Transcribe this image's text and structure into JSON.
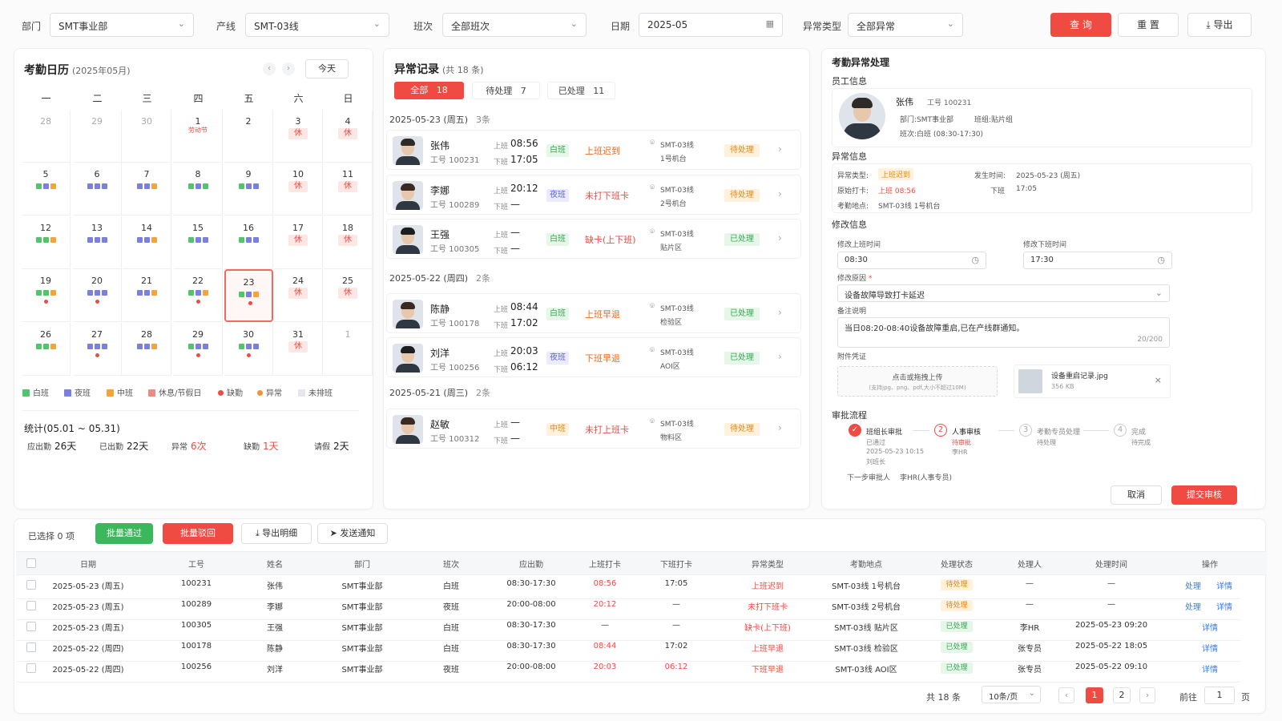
{
  "filters": {
    "dept_label": "部门",
    "dept_value": "SMT事业部",
    "line_label": "产线",
    "line_value": "SMT-03线",
    "shift_label": "班次",
    "shift_value": "全部班次",
    "date_label": "日期",
    "date_value": "2025-05",
    "type_label": "异常类型",
    "type_value": "全部异常",
    "query": "查 询",
    "reset": "重 置",
    "export": "导出"
  },
  "calendar": {
    "title": "考勤日历",
    "subtitle": "(2025年05月)",
    "today": "今天",
    "weekdays": [
      "一",
      "二",
      "三",
      "四",
      "五",
      "六",
      "日"
    ],
    "days": [
      {
        "n": "28",
        "dim": true
      },
      {
        "n": "29",
        "dim": true
      },
      {
        "n": "30",
        "dim": true
      },
      {
        "n": "1",
        "fest": "劳动节"
      },
      {
        "n": "2"
      },
      {
        "n": "3",
        "rest": "休"
      },
      {
        "n": "4",
        "rest": "休"
      },
      {
        "n": "5",
        "d": "gpo"
      },
      {
        "n": "6",
        "d": "ppp"
      },
      {
        "n": "7",
        "d": "ppo"
      },
      {
        "n": "8",
        "d": "gpg"
      },
      {
        "n": "9",
        "d": "gpp"
      },
      {
        "n": "10",
        "rest": "休"
      },
      {
        "n": "11",
        "rest": "休"
      },
      {
        "n": "12",
        "d": "ggo"
      },
      {
        "n": "13",
        "d": "ppp"
      },
      {
        "n": "14",
        "d": "ppo"
      },
      {
        "n": "15",
        "d": "gpp"
      },
      {
        "n": "16",
        "d": "gpp"
      },
      {
        "n": "17",
        "rest": "休"
      },
      {
        "n": "18",
        "rest": "休"
      },
      {
        "n": "19",
        "d": "ggo",
        "dot": "r"
      },
      {
        "n": "20",
        "d": "ppp",
        "dot": "r"
      },
      {
        "n": "21",
        "d": "ppo"
      },
      {
        "n": "22",
        "d": "gpo",
        "dot": "r"
      },
      {
        "n": "23",
        "d": "gpo",
        "dot": "r",
        "sel": true
      },
      {
        "n": "24",
        "rest": "休"
      },
      {
        "n": "25",
        "rest": "休"
      },
      {
        "n": "26",
        "d": "ggo"
      },
      {
        "n": "27",
        "d": "ppp",
        "dot": "r"
      },
      {
        "n": "28",
        "d": "ppo"
      },
      {
        "n": "29",
        "d": "gpp",
        "dot": "r"
      },
      {
        "n": "30",
        "d": "gpp",
        "dot": "r"
      },
      {
        "n": "31",
        "rest": "休"
      },
      {
        "n": "1",
        "dim": true
      }
    ],
    "legend": [
      "白班",
      "夜班",
      "中班",
      "休息/节假日",
      "缺勤",
      "异常",
      "未排班"
    ],
    "stats_title": "统计(05.01 ~ 05.31)",
    "stats": [
      {
        "label": "应出勤",
        "value": "26天"
      },
      {
        "label": "已出勤",
        "value": "22天"
      },
      {
        "label": "异常",
        "value": "6次",
        "red": true
      },
      {
        "label": "缺勤",
        "value": "1天",
        "red": true
      },
      {
        "label": "请假",
        "value": "2天"
      }
    ]
  },
  "records": {
    "title": "异常记录",
    "subtitle": "(共 18 条)",
    "tabs": [
      {
        "label": "全部",
        "count": "18"
      },
      {
        "label": "待处理",
        "count": "7"
      },
      {
        "label": "已处理",
        "count": "11"
      }
    ],
    "groups": [
      {
        "date": "2025-05-23 (周五)",
        "count": "3条"
      },
      {
        "date": "2025-05-22 (周四)",
        "count": "2条"
      },
      {
        "date": "2025-05-21 (周三)",
        "count": "2条"
      }
    ],
    "on_label": "上班",
    "off_label": "下班",
    "items": [
      {
        "name": "张伟",
        "id": "工号 100231",
        "on": "08:56",
        "off": "17:05",
        "shift": "白班",
        "stype": "day",
        "type": "上班迟到",
        "twarn": true,
        "loc1": "SMT-03线",
        "loc2": "1号机台",
        "status": "待处理",
        "st": "pend",
        "hair": "#2d2a28"
      },
      {
        "name": "李娜",
        "id": "工号 100289",
        "on": "20:12",
        "off": "—",
        "shift": "夜班",
        "stype": "night",
        "type": "未打下班卡",
        "twarn": false,
        "loc1": "SMT-03线",
        "loc2": "2号机台",
        "status": "待处理",
        "st": "pend",
        "hair": "#3a2a22"
      },
      {
        "name": "王强",
        "id": "工号 100305",
        "on": "—",
        "off": "—",
        "shift": "白班",
        "stype": "day",
        "type": "缺卡(上下班)",
        "twarn": false,
        "loc1": "SMT-03线",
        "loc2": "贴片区",
        "status": "已处理",
        "st": "done",
        "hair": "#1e1e1e"
      },
      {
        "name": "陈静",
        "id": "工号 100178",
        "on": "08:44",
        "off": "17:02",
        "shift": "白班",
        "stype": "day",
        "type": "上班早退",
        "twarn": true,
        "loc1": "SMT-03线",
        "loc2": "检验区",
        "status": "已处理",
        "st": "done",
        "hair": "#3a2a22"
      },
      {
        "name": "刘洋",
        "id": "工号 100256",
        "on": "20:03",
        "off": "06:12",
        "shift": "夜班",
        "stype": "night",
        "type": "下班早退",
        "twarn": true,
        "loc1": "SMT-03线",
        "loc2": "AOI区",
        "status": "已处理",
        "st": "done",
        "hair": "#1e1e1e"
      },
      {
        "name": "赵敏",
        "id": "工号 100312",
        "on": "—",
        "off": "—",
        "shift": "中班",
        "stype": "mid",
        "type": "未打上班卡",
        "twarn": false,
        "loc1": "SMT-03线",
        "loc2": "物料区",
        "status": "待处理",
        "st": "pend",
        "hair": "#3a2a22"
      }
    ]
  },
  "handler": {
    "title": "考勤异常处理",
    "emp_section": "员工信息",
    "emp_name": "张伟",
    "emp_id": "工号 100231",
    "emp_dept": "部门:SMT事业部",
    "emp_team": "班组:贴片组",
    "emp_shift": "班次:白班 (08:30-17:30)",
    "abn_section": "异常信息",
    "abn_type_label": "异常类型:",
    "abn_type": "上班迟到",
    "abn_time_label": "发生时间:",
    "abn_time": "2025-05-23 (周五)",
    "orig_label": "原始打卡:",
    "orig_on": "上班 08:56",
    "orig_off_label": "下班",
    "orig_off": "17:05",
    "place_label": "考勤地点:",
    "place": "SMT-03线 1号机台",
    "mod_section": "修改信息",
    "mod_on_label": "修改上班时间",
    "mod_on": "08:30",
    "mod_off_label": "修改下班时间",
    "mod_off": "17:30",
    "reason_label": "修改原因",
    "reason": "设备故障导致打卡延迟",
    "remark_label": "备注说明",
    "remark": "当日08:20-08:40设备故障重启,已在产线群通知。",
    "remark_count": "20/200",
    "attach_label": "附件凭证",
    "upload_text": "点击或拖拽上传",
    "upload_hint": "(支持jpg、png、pdf,大小不超过10M)",
    "file_name": "设备重启记录.jpg",
    "file_size": "356 KB",
    "flow_section": "审批流程",
    "steps": [
      {
        "name": "班组长审批",
        "s1": "已通过",
        "s2": "2025-05-23 10:15",
        "s3": "刘班长"
      },
      {
        "name": "人事审核",
        "s1": "待审批",
        "s2": "李HR",
        "s3": ""
      },
      {
        "name": "考勤专员处理",
        "s1": "待处理",
        "s2": "",
        "s3": ""
      },
      {
        "name": "完成",
        "s1": "待完成",
        "s2": "",
        "s3": ""
      }
    ],
    "next_label": "下一步审批人",
    "next_value": "李HR(人事专员)",
    "cancel": "取消",
    "submit": "提交审核"
  },
  "bulk": {
    "selected": "已选择 0 项",
    "approve": "批量通过",
    "reject": "批量驳回",
    "export": "导出明细",
    "notify": "发送通知"
  },
  "table": {
    "headers": [
      "日期",
      "工号",
      "姓名",
      "部门",
      "班次",
      "应出勤",
      "上班打卡",
      "下班打卡",
      "异常类型",
      "考勤地点",
      "处理状态",
      "处理人",
      "处理时间",
      "操作"
    ],
    "rows": [
      [
        "2025-05-23 (周五)",
        "100231",
        "张伟",
        "SMT事业部",
        "白班",
        "08:30-17:30",
        "08:56",
        "17:05",
        "上班迟到",
        "SMT-03线 1号机台",
        "待处理",
        "—",
        "—"
      ],
      [
        "2025-05-23 (周五)",
        "100289",
        "李娜",
        "SMT事业部",
        "夜班",
        "20:00-08:00",
        "20:12",
        "—",
        "未打下班卡",
        "SMT-03线 2号机台",
        "待处理",
        "—",
        "—"
      ],
      [
        "2025-05-23 (周五)",
        "100305",
        "王强",
        "SMT事业部",
        "白班",
        "08:30-17:30",
        "—",
        "—",
        "缺卡(上下班)",
        "SMT-03线 贴片区",
        "已处理",
        "李HR",
        "2025-05-23 09:20"
      ],
      [
        "2025-05-22 (周四)",
        "100178",
        "陈静",
        "SMT事业部",
        "白班",
        "08:30-17:30",
        "08:44",
        "17:02",
        "上班早退",
        "SMT-03线 检验区",
        "已处理",
        "张专员",
        "2025-05-22 18:05"
      ],
      [
        "2025-05-22 (周四)",
        "100256",
        "刘洋",
        "SMT事业部",
        "夜班",
        "20:00-08:00",
        "20:03",
        "06:12",
        "下班早退",
        "SMT-03线 AOI区",
        "已处理",
        "张专员",
        "2025-05-22 09:10"
      ]
    ],
    "op_handle": "处理",
    "op_detail": "详情"
  },
  "pagination": {
    "total": "共 18 条",
    "size": "10条/页",
    "pages": [
      "1",
      "2"
    ],
    "goto": "前往",
    "page_input": "1",
    "page_unit": "页"
  },
  "colors": {
    "accent": "#ef4b42",
    "day": "#52c46b",
    "night": "#7a7fe0",
    "mid": "#f5a33a"
  }
}
